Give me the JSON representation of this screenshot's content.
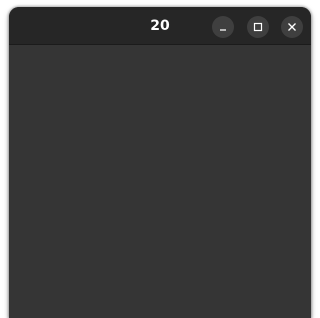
{
  "window": {
    "title": "20",
    "controls": {
      "minimize_icon": "minimize-icon",
      "maximize_icon": "maximize-icon",
      "close_icon": "close-icon"
    }
  },
  "colors": {
    "titlebar": "#262626",
    "content": "#353535",
    "button_bg": "#3f3f3f",
    "text": "#ffffff"
  }
}
